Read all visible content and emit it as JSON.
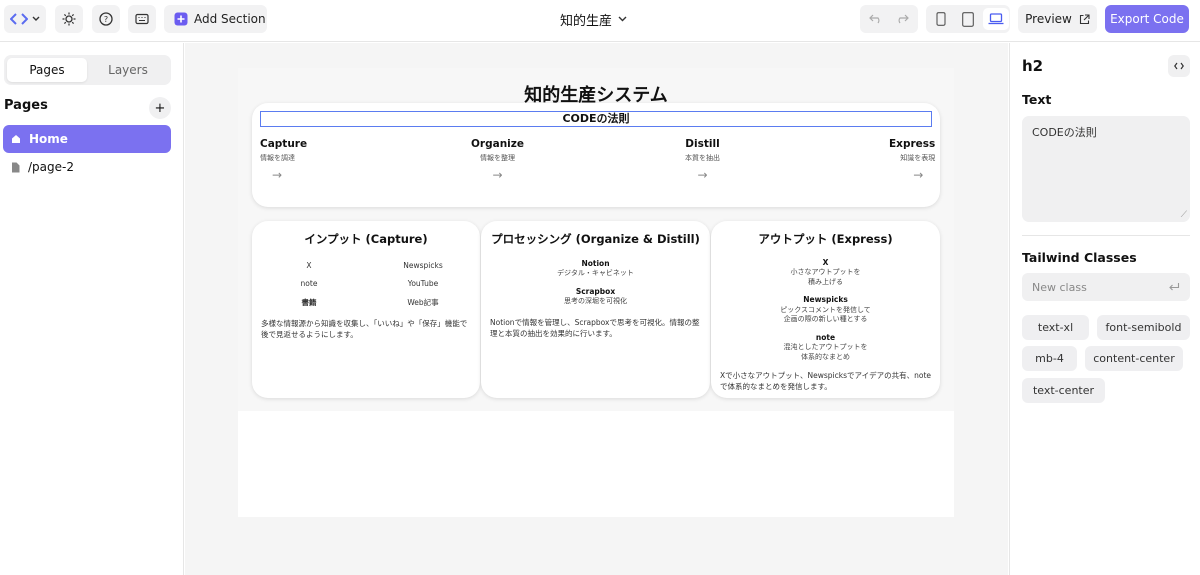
{
  "toolbar": {
    "logo_icon": "code-brackets-icon",
    "theme_icon": "sun-icon",
    "help_icon": "question-circle-icon",
    "keyboard_icon": "keyboard-icon",
    "add_section_label": "Add Section",
    "project_title": "知的生産",
    "preview_label": "Preview",
    "export_label": "Export Code"
  },
  "sidebar": {
    "tabs": [
      "Pages",
      "Layers"
    ],
    "pages_title": "Pages",
    "add_label": "+",
    "pages": [
      {
        "label": "Home",
        "icon": "home-icon",
        "active": true
      },
      {
        "label": "/page-2",
        "icon": "file-icon",
        "active": false
      }
    ]
  },
  "canvas": {
    "title": "知的生産システム",
    "selected_heading": "CODEの法則",
    "steps": [
      {
        "title": "Capture",
        "sub": "情報を調達",
        "arrow": "→"
      },
      {
        "title": "Organize",
        "sub": "情報を整理",
        "arrow": "→"
      },
      {
        "title": "Distill",
        "sub": "本質を抽出",
        "arrow": "→"
      },
      {
        "title": "Express",
        "sub": "知識を表現",
        "arrow": "→"
      }
    ],
    "input": {
      "title": "インプット (Capture)",
      "items": [
        "X",
        "Newspicks",
        "note",
        "YouTube",
        "書籍",
        "Web記事"
      ],
      "desc": "多様な情報源から知識を収集し、「いいね」や「保存」機能で後で見返せるようにします。"
    },
    "processing": {
      "title": "プロセッシング (Organize & Distill)",
      "items": [
        {
          "name": "Notion",
          "desc": "デジタル・キャビネット"
        },
        {
          "name": "Scrapbox",
          "desc": "思考の深堀を可視化"
        }
      ],
      "desc": "Notionで情報を管理し、Scrapboxで思考を可視化。情報の整理と本質の抽出を効果的に行います。"
    },
    "output": {
      "title": "アウトプット (Express)",
      "items": [
        {
          "name": "X",
          "desc1": "小さなアウトプットを",
          "desc2": "積み上げる"
        },
        {
          "name": "Newspicks",
          "desc1": "ピックスコメントを発信して",
          "desc2": "企画の際の新しい種とする"
        },
        {
          "name": "note",
          "desc1": "混沌としたアウトプットを",
          "desc2": "体系的なまとめ"
        }
      ],
      "desc": "Xで小さなアウトプット、Newspicksでアイデアの共有、noteで体系的なまとめを発信します。"
    }
  },
  "panel": {
    "element": "h2",
    "text_label": "Text",
    "text_value": "CODEの法則",
    "classes_label": "Tailwind Classes",
    "new_class_placeholder": "New class",
    "classes": [
      "text-xl",
      "font-semibold",
      "mb-4",
      "content-center",
      "text-center"
    ]
  }
}
